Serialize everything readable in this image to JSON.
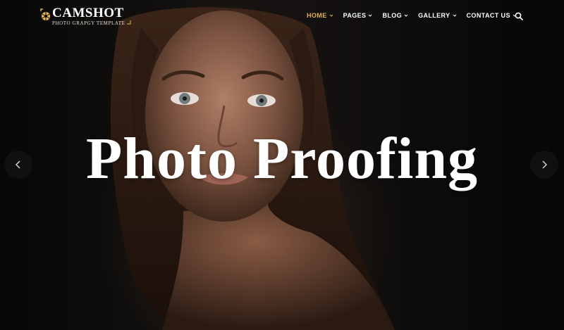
{
  "brand": {
    "title": "CAMSHOT",
    "tagline": "PHOTO GRAPGY TEMPLATE",
    "icon": "camera-aperture-icon",
    "accent_color": "#e4b454"
  },
  "nav": {
    "items": [
      {
        "label": "HOME",
        "active": true
      },
      {
        "label": "PAGES",
        "active": false
      },
      {
        "label": "BLOG",
        "active": false
      },
      {
        "label": "GALLERY",
        "active": false
      },
      {
        "label": "CONTACT US",
        "active": false
      }
    ],
    "search_icon": "search-icon"
  },
  "hero": {
    "headline": "Photo Proofing",
    "prev_icon": "chevron-left-icon",
    "next_icon": "chevron-right-icon"
  }
}
